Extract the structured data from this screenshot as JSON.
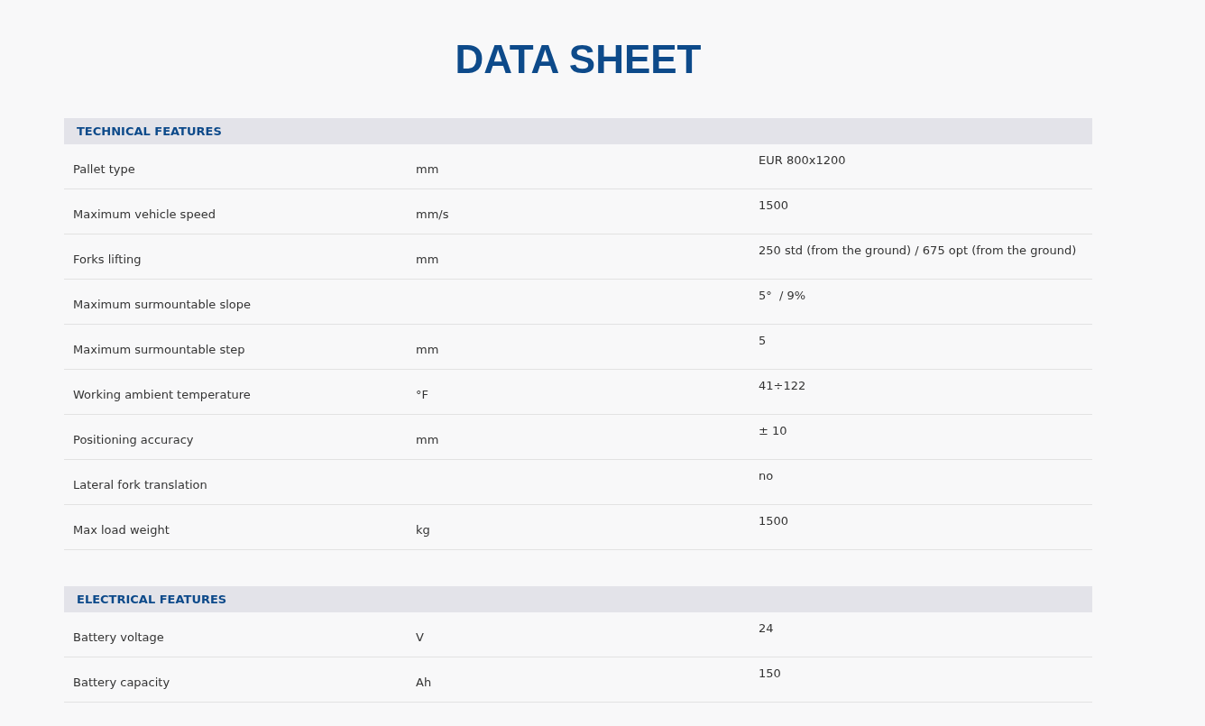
{
  "title": "DATA SHEET",
  "sections": [
    {
      "heading": "TECHNICAL FEATURES",
      "rows": [
        {
          "name": "Pallet type",
          "unit": "mm",
          "value": "EUR 800x1200"
        },
        {
          "name": "Maximum vehicle speed",
          "unit": "mm/s",
          "value": "1500"
        },
        {
          "name": "Forks lifting",
          "unit": "mm",
          "value": "250 std (from the ground) / 675 opt (from the ground)"
        },
        {
          "name": "Maximum surmountable slope",
          "unit": "",
          "value": "5°  / 9%"
        },
        {
          "name": "Maximum surmountable step",
          "unit": "mm",
          "value": "5"
        },
        {
          "name": "Working ambient temperature",
          "unit": "°F",
          "value": "41÷122"
        },
        {
          "name": "Positioning accuracy",
          "unit": "mm",
          "value": "± 10"
        },
        {
          "name": "Lateral fork translation",
          "unit": "",
          "value": "no"
        },
        {
          "name": "Max load weight",
          "unit": "kg",
          "value": "1500"
        }
      ]
    },
    {
      "heading": "ELECTRICAL FEATURES",
      "rows": [
        {
          "name": "Battery voltage",
          "unit": "V",
          "value": "24"
        },
        {
          "name": "Battery capacity",
          "unit": "Ah",
          "value": "150"
        }
      ]
    }
  ]
}
